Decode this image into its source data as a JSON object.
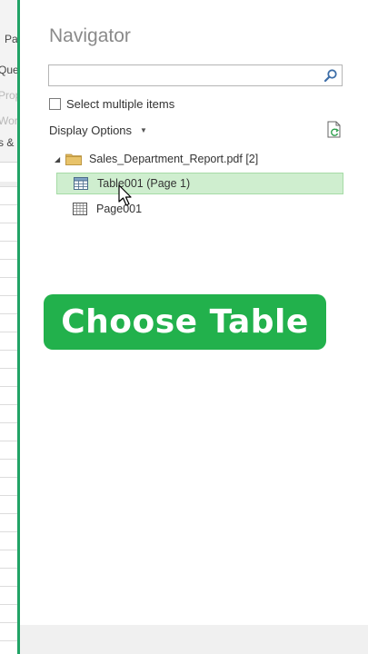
{
  "background_app": {
    "fragments": [
      "Pa",
      "Quer",
      "Prop",
      "Work",
      "s &"
    ]
  },
  "navigator": {
    "title": "Navigator",
    "search": {
      "value": "",
      "placeholder": ""
    },
    "select_multiple_label": "Select multiple items",
    "display_options_label": "Display Options",
    "tree": {
      "root": {
        "label": "Sales_Department_Report.pdf [2]"
      },
      "items": [
        {
          "label": "Table001 (Page 1)",
          "selected": true,
          "icon": "table-icon"
        },
        {
          "label": "Page001",
          "selected": false,
          "icon": "page-grid-icon"
        }
      ]
    }
  },
  "overlay": {
    "banner_text": "Choose Table"
  },
  "colors": {
    "accent_green": "#21a366",
    "banner_green": "#22b14c",
    "selection": "#cfeecf"
  }
}
